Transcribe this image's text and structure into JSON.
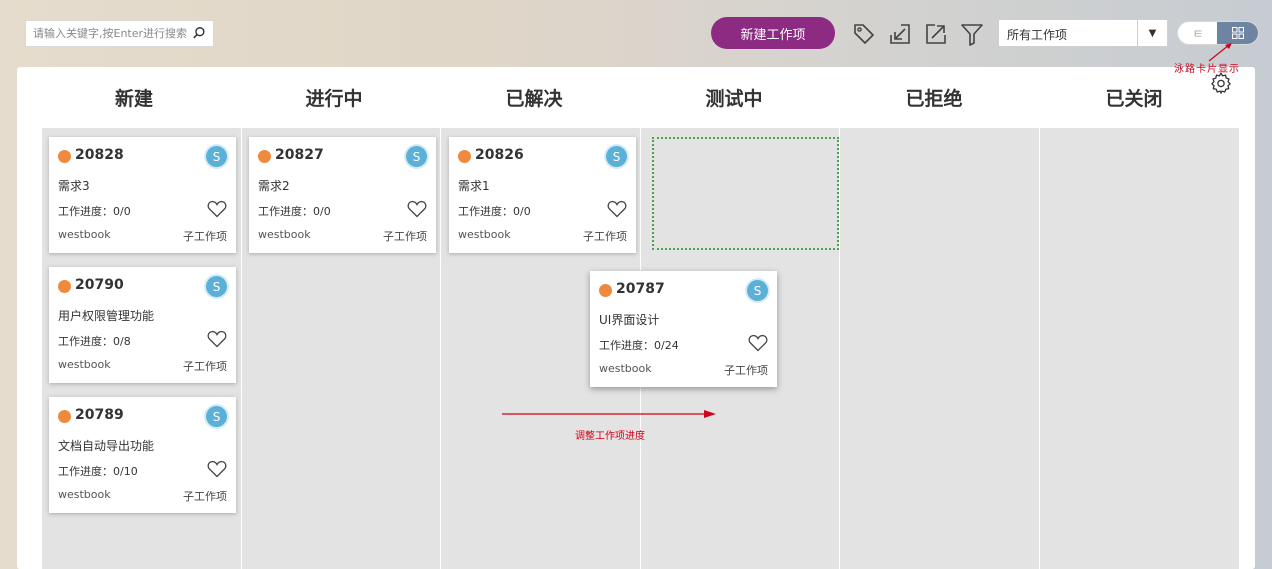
{
  "toolbar": {
    "search_placeholder": "请输入关键字,按Enter进行搜索",
    "new_button_label": "新建工作项",
    "filter_select_value": "所有工作项",
    "view_list_label": "ㅌ"
  },
  "annotations": {
    "card_view_note": "泳路卡片显示",
    "drag_note": "调整工作项进度"
  },
  "columns": [
    "新建",
    "进行中",
    "已解决",
    "测试中",
    "已拒绝",
    "已关闭"
  ],
  "cards": [
    {
      "id": "20828",
      "avatar": "S",
      "title": "需求3",
      "progress": "工作进度：0/0",
      "project": "westbook",
      "sub": "子工作项"
    },
    {
      "id": "20790",
      "avatar": "S",
      "title": "用户权限管理功能",
      "progress": "工作进度：0/8",
      "project": "westbook",
      "sub": "子工作项"
    },
    {
      "id": "20789",
      "avatar": "S",
      "title": "文档自动导出功能",
      "progress": "工作进度：0/10",
      "project": "westbook",
      "sub": "子工作项"
    },
    {
      "id": "20827",
      "avatar": "S",
      "title": "需求2",
      "progress": "工作进度：0/0",
      "project": "westbook",
      "sub": "子工作项"
    },
    {
      "id": "20826",
      "avatar": "S",
      "title": "需求1",
      "progress": "工作进度：0/0",
      "project": "westbook",
      "sub": "子工作项"
    },
    {
      "id": "20787",
      "avatar": "S",
      "title": "UI界面设计",
      "progress": "工作进度：0/24",
      "project": "westbook",
      "sub": "子工作项"
    }
  ],
  "colors": {
    "accent": "#8d2b83",
    "priority_dot": "#ee8a3e",
    "avatar": "#5bb0d8",
    "annotation": "#d0021b",
    "drop_zone": "#4aa54a"
  },
  "icons": [
    "search-icon",
    "tag-icon",
    "import-icon",
    "export-icon",
    "filter-icon",
    "chevron-down-icon",
    "grid-icon",
    "gear-icon",
    "heart-icon"
  ]
}
